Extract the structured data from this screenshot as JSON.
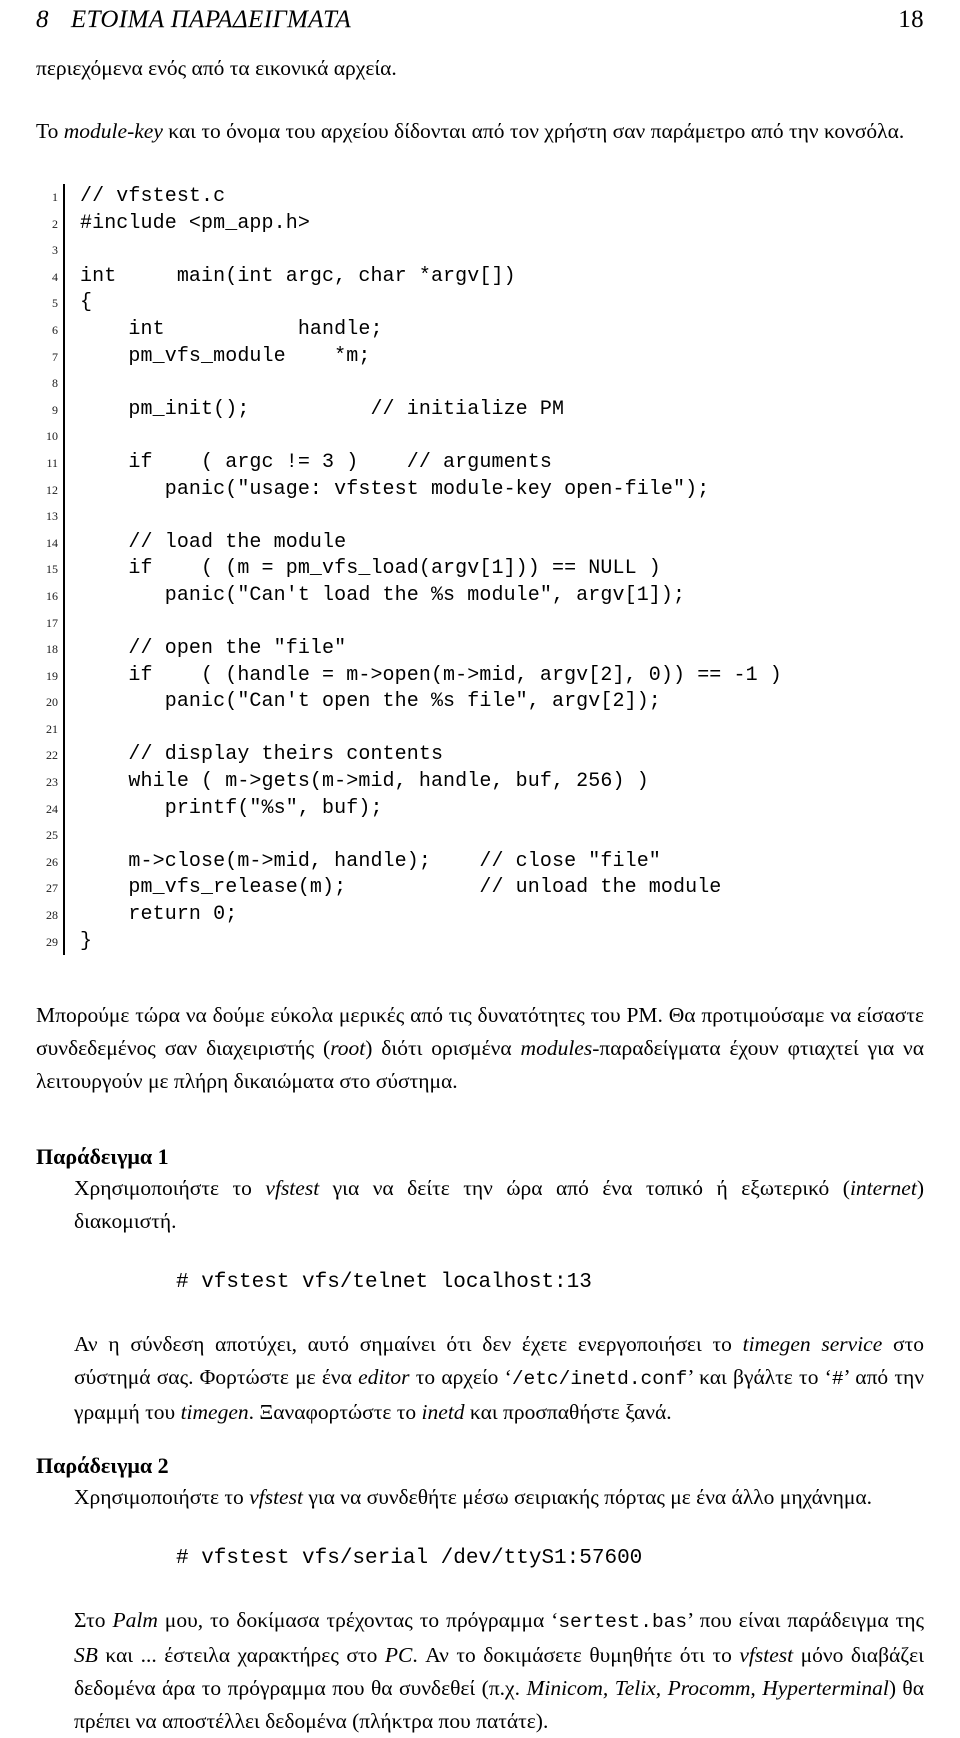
{
  "header": {
    "section_number": "8",
    "section_title": "ΕΤΟΙΜΑ ΠΑΡΑΔΕΙΓΜΑΤΑ",
    "page_number": "18"
  },
  "intro": {
    "line1": "περιεχόμενα ενός από τα εικονικά αρχεία.",
    "line2_prefix": "Το ",
    "line2_italic": "module-key",
    "line2_suffix": " και το όνομα του αρχείου δίδονται από τον χρήστη σαν παράμετρο από την κονσόλα."
  },
  "listing": {
    "lines": [
      {
        "n": "1",
        "code": "// vfstest.c"
      },
      {
        "n": "2",
        "code": "#include <pm_app.h>"
      },
      {
        "n": "3",
        "code": ""
      },
      {
        "n": "4",
        "code": "int     main(int argc, char *argv[])"
      },
      {
        "n": "5",
        "code": "{"
      },
      {
        "n": "6",
        "code": "    int           handle;"
      },
      {
        "n": "7",
        "code": "    pm_vfs_module    *m;"
      },
      {
        "n": "8",
        "code": ""
      },
      {
        "n": "9",
        "code": "    pm_init();          // initialize PM"
      },
      {
        "n": "10",
        "code": ""
      },
      {
        "n": "11",
        "code": "    if    ( argc != 3 )    // arguments"
      },
      {
        "n": "12",
        "code": "       panic(\"usage: vfstest module-key open-file\");"
      },
      {
        "n": "13",
        "code": ""
      },
      {
        "n": "14",
        "code": "    // load the module"
      },
      {
        "n": "15",
        "code": "    if    ( (m = pm_vfs_load(argv[1])) == NULL )"
      },
      {
        "n": "16",
        "code": "       panic(\"Can't load the %s module\", argv[1]);"
      },
      {
        "n": "17",
        "code": ""
      },
      {
        "n": "18",
        "code": "    // open the \"file\""
      },
      {
        "n": "19",
        "code": "    if    ( (handle = m->open(m->mid, argv[2], 0)) == -1 )"
      },
      {
        "n": "20",
        "code": "       panic(\"Can't open the %s file\", argv[2]);"
      },
      {
        "n": "21",
        "code": ""
      },
      {
        "n": "22",
        "code": "    // display theirs contents"
      },
      {
        "n": "23",
        "code": "    while ( m->gets(m->mid, handle, buf, 256) )"
      },
      {
        "n": "24",
        "code": "       printf(\"%s\", buf);"
      },
      {
        "n": "25",
        "code": ""
      },
      {
        "n": "26",
        "code": "    m->close(m->mid, handle);    // close \"file\""
      },
      {
        "n": "27",
        "code": "    pm_vfs_release(m);           // unload the module"
      },
      {
        "n": "28",
        "code": "    return 0;"
      },
      {
        "n": "29",
        "code": "}"
      }
    ]
  },
  "after_listing": {
    "seg1": "Μπορούμε τώρα να δούμε εύκολα μερικές από τις δυνατότητες του PM. Θα προτιμούσαμε να είσαστε συνδεδεμένος σαν διαχειριστής (",
    "seg2_italic": "root",
    "seg3": ") διότι ορισμένα ",
    "seg4_italic": "modules",
    "seg5": "-παραδείγματα έχουν φτιαχτεί για να λειτουργούν με πλήρη δικαιώματα στο σύστημα."
  },
  "example1": {
    "heading": "Παράδειγμα 1",
    "body_seg1": "Χρησιμοποιήστε το ",
    "body_italic1": "vfstest",
    "body_seg2": " για να δείτε την ώρα από ένα τοπικό ή εξωτερικό (",
    "body_italic2": "internet",
    "body_seg3": ") διακομιστή.",
    "command": "# vfstest vfs/telnet localhost:13",
    "note_seg1": "Αν η σύνδεση αποτύχει, αυτό σημαίνει ότι δεν έχετε ενεργοποιήσει το ",
    "note_italic1": "timegen service",
    "note_seg2": " στο σύστημά σας. Φορτώστε με ένα ",
    "note_italic2": "editor",
    "note_seg3": " το αρχείο ‘",
    "note_tt1": "/etc/inetd.conf",
    "note_seg4": "’ και βγάλτε το ‘",
    "note_tt2": "#",
    "note_seg5": "’ από την γραμμή του ",
    "note_italic3": "timegen",
    "note_seg6": ". Ξαναφορτώστε το ",
    "note_italic4": "inetd",
    "note_seg7": " και προσπαθήστε ξανά."
  },
  "example2": {
    "heading": "Παράδειγμα 2",
    "body_seg1": "Χρησιμοποιήστε το ",
    "body_italic1": "vfstest",
    "body_seg2": " για να συνδεθήτε μέσω σειριακής πόρτας με ένα άλλο μηχάνημα.",
    "command": "# vfstest vfs/serial /dev/ttyS1:57600",
    "note_seg1": "Στο ",
    "note_italic1": "Palm",
    "note_seg2": " μου, το δοκίμασα τρέχοντας το πρόγραμμα ‘",
    "note_tt1": "sertest.bas",
    "note_seg3": "’ που είναι παράδειγμα της ",
    "note_italic2": "SB",
    "note_seg4": " και ... έστειλα χαρακτήρες στο ",
    "note_italic3": "PC",
    "note_seg5": ". Αν το δοκιμάσετε θυμηθήτε ότι το ",
    "note_italic4": "vfstest",
    "note_seg6": " μόνο διαβάζει δεδομένα άρα το πρόγραμμα που θα συνδεθεί (π.χ. ",
    "note_italic5": "Minicom, Telix, Procomm, Hyperterminal",
    "note_seg7": ") θα πρέπει να αποστέλλει δεδομένα (πλήκτρα που πατάτε)."
  }
}
